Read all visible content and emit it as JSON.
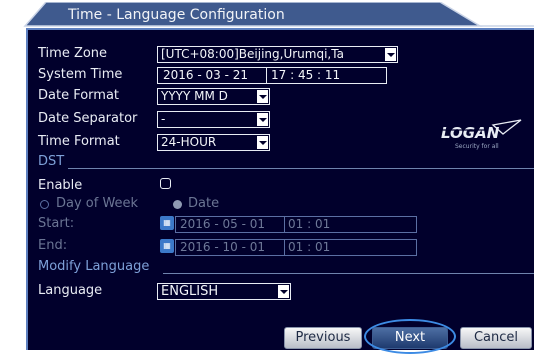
{
  "window": {
    "title": "Time - Language Configuration"
  },
  "time": {
    "zone_label": "Time Zone",
    "zone_value": "[UTC+08:00]Beijing,Urumqi,Ta",
    "system_time_label": "System Time",
    "system_date": "2016 - 03 - 21",
    "system_clock": "17 : 45 : 11",
    "date_format_label": "Date Format",
    "date_format_value": "YYYY MM D",
    "date_separator_label": "Date Separator",
    "date_separator_value": "-",
    "time_format_label": "Time Format",
    "time_format_value": "24-HOUR"
  },
  "dst": {
    "section_label": "DST",
    "enable_label": "Enable",
    "enabled": false,
    "day_of_week_label": "Day of Week",
    "date_label": "Date",
    "selected_mode": "Date",
    "start_label": "Start:",
    "start_date": "2016 - 05 - 01",
    "start_time": "01 : 01",
    "end_label": "End:",
    "end_date": "2016 - 10 - 01",
    "end_time": "01 : 01"
  },
  "language": {
    "section_label": "Modify Language",
    "label": "Language",
    "value": "ENGLISH"
  },
  "logo": {
    "brand": "LOGAN",
    "tagline": "Security for all"
  },
  "buttons": {
    "previous": "Previous",
    "next": "Next",
    "cancel": "Cancel"
  },
  "colors": {
    "panel_bg": "#01002c",
    "title_bg": "#3f5a8e",
    "accent_ring": "#3d8be4",
    "section_text": "#7ea0d8"
  }
}
